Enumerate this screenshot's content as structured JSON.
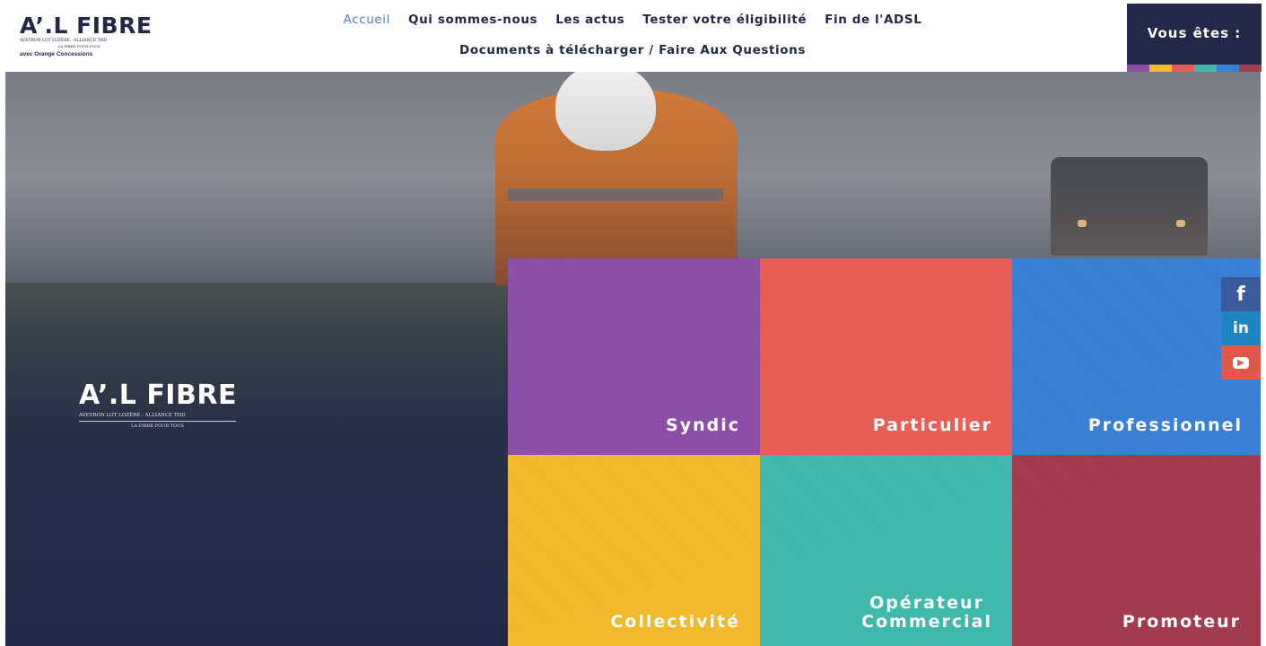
{
  "header": {
    "logo": {
      "word": "A’.L FIBRE",
      "line1": "AVEYRON LOT LOZÈRE - ALLIANCE THD",
      "line2": "LA FIBRE POUR TOUS",
      "line3": "avec Orange Concessions"
    },
    "nav": {
      "row1": [
        "Accueil",
        "Qui sommes-nous",
        "Les actus",
        "Tester votre éligibilité",
        "Fin de l'ADSL"
      ],
      "row2": [
        "Documents à télécharger / Faire Aux Questions"
      ],
      "active": "Accueil"
    },
    "vous_etes": {
      "label": "Vous êtes :",
      "strip_colors": [
        "#8b4fa8",
        "#f2b92c",
        "#e85d54",
        "#3fb8ab",
        "#3a7fd5",
        "#a33b4f"
      ]
    }
  },
  "hero": {
    "logo": {
      "word": "A’.L FIBRE",
      "line1": "AVEYRON LOT LOZÈRE - ALLIANCE THD",
      "line2": "LA FIBRE POUR TOUS"
    }
  },
  "tiles": [
    {
      "label": "Syndic",
      "color": "#8b4fa8"
    },
    {
      "label": "Particulier",
      "color": "#e85d54"
    },
    {
      "label": "Professionnel",
      "color": "#3a7fd5"
    },
    {
      "label": "Collectivité",
      "color": "#f2b92c"
    },
    {
      "label": "Opérateur\nCommercial",
      "color": "#3fb8ab"
    },
    {
      "label": "Promoteur",
      "color": "#a33b4f"
    }
  ],
  "social": [
    {
      "icon": "facebook-icon",
      "glyph": "f",
      "color": "#3b5a9a"
    },
    {
      "icon": "linkedin-icon",
      "glyph": "in",
      "color": "#1f84c2"
    },
    {
      "icon": "youtube-icon",
      "glyph": "▶",
      "color": "#e0584a"
    }
  ]
}
